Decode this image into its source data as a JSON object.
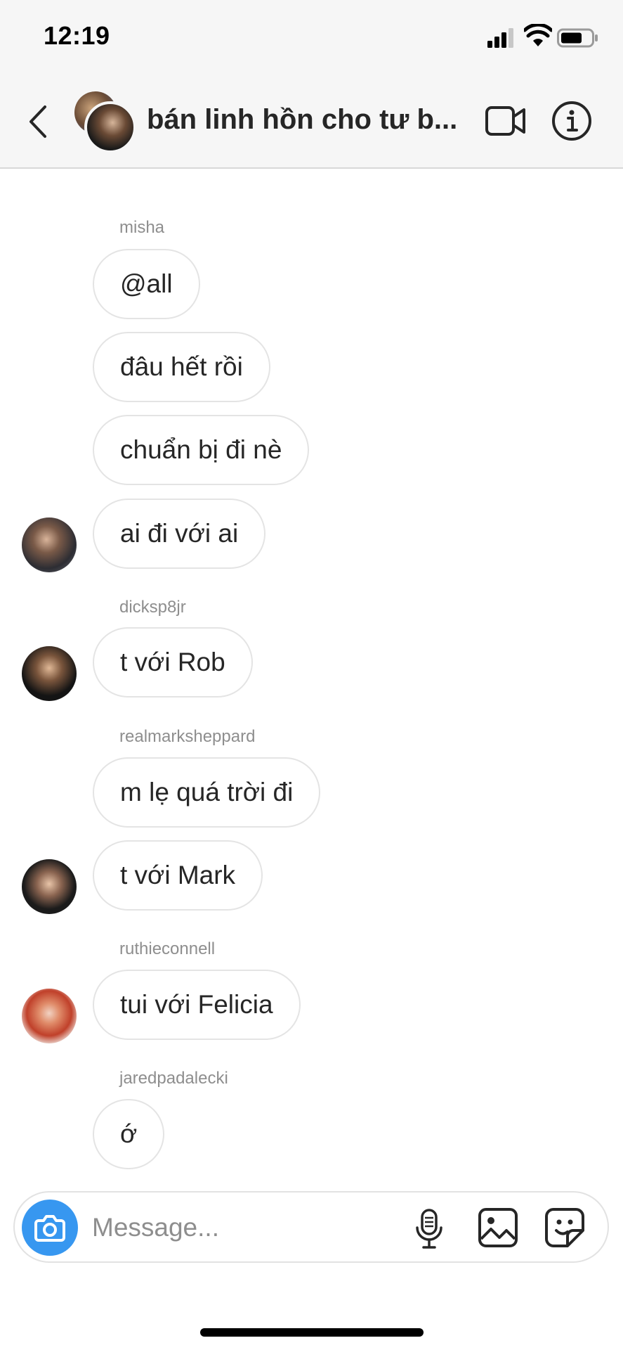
{
  "status_bar": {
    "time": "12:19"
  },
  "header": {
    "title": "bán linh hồn cho tư b..."
  },
  "messages": [
    {
      "sender": "misha",
      "bubbles": [
        "@all",
        "đâu hết rồi",
        "chuẩn bị đi nè",
        "ai đi với ai"
      ]
    },
    {
      "sender": "dicksp8jr",
      "bubbles": [
        "t với Rob"
      ]
    },
    {
      "sender": "realmarksheppard",
      "bubbles": [
        "m lẹ quá trời đi",
        "t với Mark"
      ]
    },
    {
      "sender": "ruthieconnell",
      "bubbles": [
        "tui với Felicia"
      ]
    },
    {
      "sender": "jaredpadalecki",
      "bubbles": [
        "ớ"
      ]
    }
  ],
  "composer": {
    "placeholder": "Message..."
  },
  "colors": {
    "accent": "#3797f0",
    "bubble_border": "#e4e4e4",
    "muted_text": "#8e8e8e",
    "header_bg": "#f6f6f6"
  },
  "icons": [
    "back-chevron-icon",
    "video-call-icon",
    "info-icon",
    "camera-icon",
    "microphone-icon",
    "gallery-icon",
    "sticker-icon"
  ]
}
